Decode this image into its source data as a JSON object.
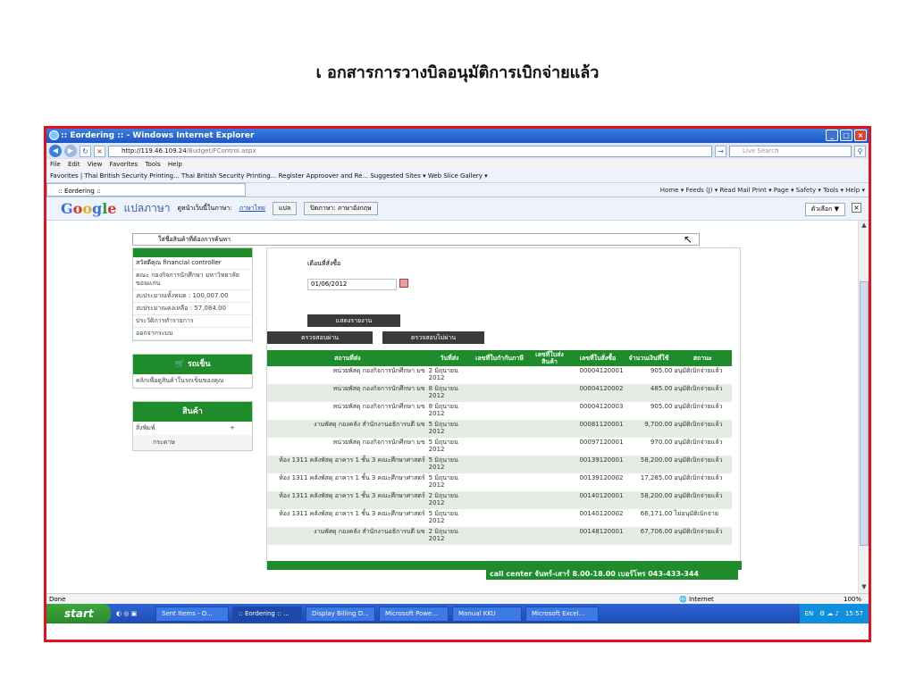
{
  "slide": {
    "title": "เ อกสารการวางบิลอนุมัติการเบิกจ่ายแล้ว"
  },
  "browser": {
    "window_title": ":: Eordering :: - Windows Internet Explorer",
    "url_host": "http://119.46.109.24",
    "url_path": "/Budget/FControl.aspx",
    "search_placeholder": "Live Search",
    "menu": "File Edit View Favorites Tools Help",
    "favorites": "Favorites  |  Thai British Security Printing...  Thai British Security Printing...  Register Approover and Re...  Suggested Sites ▾  Web Slice Gallery ▾",
    "tab_title": ":: Eordering ::",
    "command_bar": "Home ▾  Feeds (J)  ▾  Read Mail  Print ▾  Page ▾  Safety ▾  Tools ▾  Help ▾"
  },
  "google_bar": {
    "logo_g1": "G",
    "logo_o1": "o",
    "logo_o2": "o",
    "logo_g2": "g",
    "logo_l": "l",
    "logo_e": "e",
    "translate": "แปลภาษา",
    "view_prompt": "ดูหน้าเว็บนี้ในภาษา:",
    "language": "ภาษาไทย",
    "translate_btn": "แปล",
    "turn_off": "ปิดภาษา: ภาษาอังกฤษ",
    "options": "ตัวเลือก ▼",
    "close": "×"
  },
  "search_line": "ใส่ชื่อสินค้าที่ต้องการค้นหา",
  "sidebar": {
    "items": [
      "สวัสดีคุณ financial controller",
      "คณะ กองกิจการนักศึกษา มหาวิทยาลัยขอนแก่น",
      "งบประมาณทั้งหมด : 100,007.00",
      "งบประมาณคงเหลือ : 57,084.00",
      "ประวัติการทำรายการ",
      "ออกจากระบบ"
    ],
    "cart_title": "รถเข็น",
    "cart_link": "คลิกเพื่อดูสินค้าในรถเข็นของคุณ",
    "products_title": "สินค้า",
    "category": "สิ่งพิมพ์",
    "category_plus": "+",
    "subcategory": "กระดาษ"
  },
  "form": {
    "month_label": "เดือนที่สั่งซื้อ",
    "date_value": "01/06/2012",
    "show_btn": "แสดงรายงาน",
    "tab_passed": "ตรวจสอบผ่าน",
    "tab_failed": "ตรวจสอบไม่ผ่าน"
  },
  "table": {
    "headers": [
      "สถานที่ส่ง",
      "วันที่ส่ง",
      "เลขที่ใบกำกับภาษี",
      "เลขที่ใบส่งสินค้า",
      "เลขที่ใบสั่งซื้อ",
      "จำนวนเงินที่ใช้",
      "สถานะ"
    ],
    "rows": [
      {
        "loc": "หน่วยพัสดุ กองกิจการนักศึกษา มข",
        "date": "2 มิถุนายน 2012",
        "tax": "",
        "del": "",
        "po": "00004120001",
        "amt": "905.00",
        "status": "อนุมัติเบิกจ่ายแล้ว"
      },
      {
        "loc": "หน่วยพัสดุ กองกิจการนักศึกษา มข",
        "date": "8 มิถุนายน 2012",
        "tax": "",
        "del": "",
        "po": "00004120002",
        "amt": "485.00",
        "status": "อนุมัติเบิกจ่ายแล้ว"
      },
      {
        "loc": "หน่วยพัสดุ กองกิจการนักศึกษา มข",
        "date": "8 มิถุนายน 2012",
        "tax": "",
        "del": "",
        "po": "00004120003",
        "amt": "905.00",
        "status": "อนุมัติเบิกจ่ายแล้ว"
      },
      {
        "loc": "งานพัสดุ กองคลัง สำนักงานอธิการบดี มข",
        "date": "5 มิถุนายน 2012",
        "tax": "",
        "del": "",
        "po": "00081120001",
        "amt": "9,700.00",
        "status": "อนุมัติเบิกจ่ายแล้ว"
      },
      {
        "loc": "หน่วยพัสดุ กองกิจการนักศึกษา มข",
        "date": "5 มิถุนายน 2012",
        "tax": "",
        "del": "",
        "po": "00097120001",
        "amt": "970.00",
        "status": "อนุมัติเบิกจ่ายแล้ว"
      },
      {
        "loc": "ห้อง 1311 คลังพัสดุ อาคาร 1 ชั้น 3 คณะศึกษาศาสตร์",
        "date": "5 มิถุนายน 2012",
        "tax": "",
        "del": "",
        "po": "00139120001",
        "amt": "58,200.00",
        "status": "อนุมัติเบิกจ่ายแล้ว"
      },
      {
        "loc": "ห้อง 1311 คลังพัสดุ อาคาร 1 ชั้น 3 คณะศึกษาศาสตร์",
        "date": "5 มิถุนายน 2012",
        "tax": "",
        "del": "",
        "po": "00139120002",
        "amt": "17,285.00",
        "status": "อนุมัติเบิกจ่ายแล้ว"
      },
      {
        "loc": "ห้อง 1311 คลังพัสดุ อาคาร 1 ชั้น 3 คณะศึกษาศาสตร์",
        "date": "2 มิถุนายน 2012",
        "tax": "",
        "del": "",
        "po": "00140120001",
        "amt": "58,200.00",
        "status": "อนุมัติเบิกจ่ายแล้ว"
      },
      {
        "loc": "ห้อง 1311 คลังพัสดุ อาคาร 1 ชั้น 3 คณะศึกษาศาสตร์",
        "date": "5 มิถุนายน 2012",
        "tax": "",
        "del": "",
        "po": "00140120002",
        "amt": "66,171.00",
        "status": "ไม่อนุมัติเบิกจ่าย"
      },
      {
        "loc": "งานพัสดุ กองคลัง สำนักงานอธิการบดี มข",
        "date": "2 มิถุนายน 2012",
        "tax": "",
        "del": "",
        "po": "00148120001",
        "amt": "67,706.00",
        "status": "อนุมัติเบิกจ่ายแล้ว"
      }
    ]
  },
  "call_center": "call center จันทร์-เสาร์ 8.00-18.00 เบอร์โทร 043-433-344",
  "status": {
    "left": "Done",
    "zone": "Internet",
    "zoom": "100%"
  },
  "taskbar": {
    "start": "start",
    "items": [
      "Sent Items - O...",
      ":: Eordering :: ...",
      "Display Billing D...",
      "Microsoft Powe...",
      "Manual KKU",
      "Microsoft Excel..."
    ],
    "lang": "EN",
    "time": "15:57"
  }
}
